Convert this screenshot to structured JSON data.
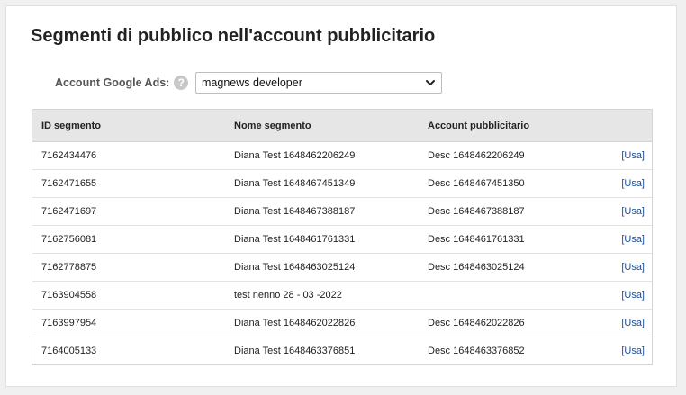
{
  "page": {
    "title": "Segmenti di pubblico nell'account pubblicitario"
  },
  "account": {
    "label": "Account Google Ads:",
    "help": "?",
    "selected": "magnews developer"
  },
  "table": {
    "headers": {
      "id": "ID segmento",
      "name": "Nome segmento",
      "account": "Account pubblicitario"
    },
    "rows": [
      {
        "id": "7162434476",
        "name": "Diana Test 1648462206249",
        "account": "Desc 1648462206249",
        "action": "[Usa]"
      },
      {
        "id": "7162471655",
        "name": "Diana Test 1648467451349",
        "account": "Desc 1648467451350",
        "action": "[Usa]"
      },
      {
        "id": "7162471697",
        "name": "Diana Test 1648467388187",
        "account": "Desc 1648467388187",
        "action": "[Usa]"
      },
      {
        "id": "7162756081",
        "name": "Diana Test 1648461761331",
        "account": "Desc 1648461761331",
        "action": "[Usa]"
      },
      {
        "id": "7162778875",
        "name": "Diana Test 1648463025124",
        "account": "Desc 1648463025124",
        "action": "[Usa]"
      },
      {
        "id": "7163904558",
        "name": "test nenno 28 - 03 -2022",
        "account": "",
        "action": "[Usa]"
      },
      {
        "id": "7163997954",
        "name": "Diana Test 1648462022826",
        "account": "Desc 1648462022826",
        "action": "[Usa]"
      },
      {
        "id": "7164005133",
        "name": "Diana Test 1648463376851",
        "account": "Desc 1648463376852",
        "action": "[Usa]"
      }
    ]
  },
  "icons": {
    "help": "help-circle-icon",
    "dropdown": "chevron-down-icon"
  },
  "colors": {
    "link": "#1a4f9c",
    "header_bg": "#e6e6e6"
  }
}
